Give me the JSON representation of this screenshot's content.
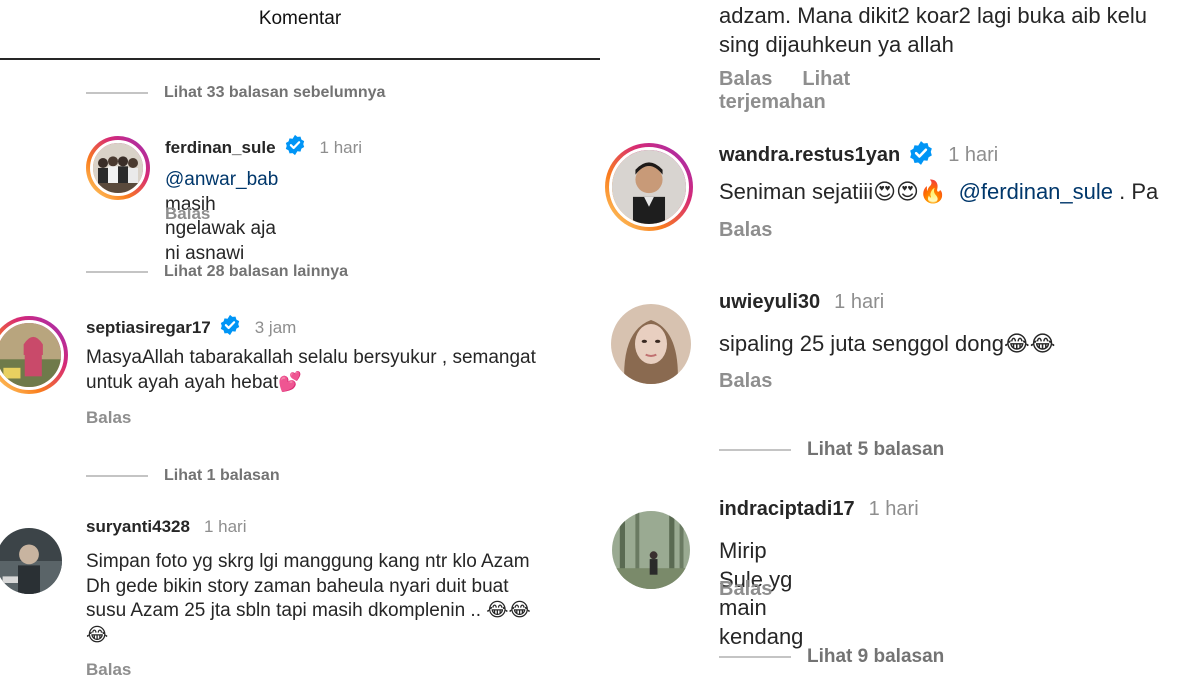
{
  "header": {
    "title": "Komentar"
  },
  "left": {
    "view_prev": "Lihat 33 balasan sebelumnya",
    "comment1": {
      "username": "ferdinan_sule",
      "time": "1 hari",
      "mention": "@anwar_bab",
      "text": " masih ngelawak aja ni asnawi",
      "reply": "Balas"
    },
    "view_more1": "Lihat 28 balasan lainnya",
    "comment2": {
      "username": "septiasiregar17",
      "time": "3 jam",
      "line1": "MasyaAllah tabarakallah selalu bersyukur , semangat",
      "line2": "untuk ayah ayah hebat",
      "emoji": "💕",
      "reply": "Balas"
    },
    "view_more2": "Lihat 1 balasan",
    "comment3": {
      "username": "suryanti4328",
      "time": "1 hari",
      "line1": "Simpan foto yg skrg lgi manggung kang ntr klo Azam",
      "line2": "Dh gede bikin story zaman baheula nyari duit buat",
      "line3": "susu Azam 25 jta sbln  tapi masih dkomplenin .. ",
      "emoji": "😂😂",
      "line4_emoji": "😂",
      "reply": "Balas"
    }
  },
  "right": {
    "top_comment": {
      "line1": "adzam.  Mana dikit2 koar2 lagi buka aib kelu",
      "line2": "sing dijauhkeun ya allah",
      "reply": "Balas",
      "translate": "Lihat terjemahan"
    },
    "comment1": {
      "username": "wandra.restus1yan",
      "time": "1 hari",
      "text": "Seniman sejatiii",
      "emojis": "😍😍🔥",
      "mention": "@ferdinan_sule",
      "trail": " . Pa",
      "reply": "Balas"
    },
    "comment2": {
      "username": "uwieyuli30",
      "time": "1 hari",
      "text": "sipaling 25 juta senggol dong",
      "emoji": "😂😂",
      "reply": "Balas"
    },
    "view_more1": "Lihat 5 balasan",
    "comment3": {
      "username": "indraciptadi17",
      "time": "1 hari",
      "text": "Mirip Sule yg main kendang",
      "reply": "Balas"
    },
    "view_more2": "Lihat 9 balasan"
  },
  "colors": {
    "text": "#262626",
    "secondary": "#8e8e8e",
    "mention": "#00376b",
    "verified": "#0095f6",
    "story_ring": [
      "#feda75",
      "#fa7e1e",
      "#d62976",
      "#962fbf"
    ]
  },
  "icons": [
    "verified-badge-icon"
  ]
}
